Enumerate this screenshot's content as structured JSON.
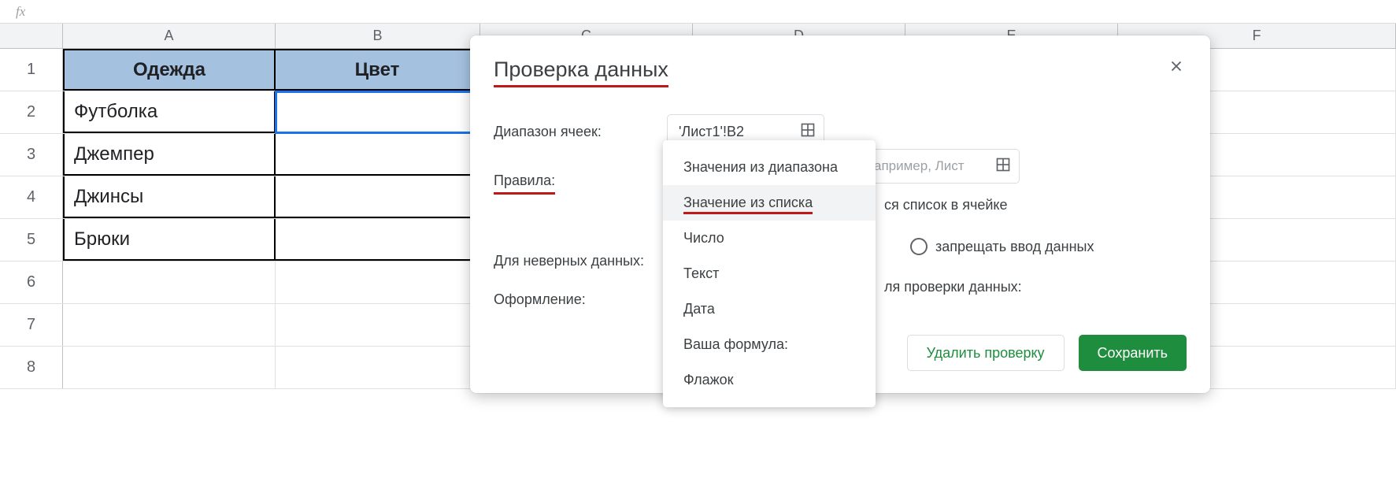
{
  "formula_bar": {
    "fx": "fx"
  },
  "columns": [
    "A",
    "B",
    "C",
    "D",
    "E",
    "F"
  ],
  "row_numbers": [
    1,
    2,
    3,
    4,
    5,
    6,
    7,
    8
  ],
  "table": {
    "header": {
      "a": "Одежда",
      "b": "Цвет"
    },
    "rows": [
      {
        "a": "Футболка",
        "b": ""
      },
      {
        "a": "Джемпер",
        "b": ""
      },
      {
        "a": "Джинсы",
        "b": ""
      },
      {
        "a": "Брюки",
        "b": ""
      }
    ]
  },
  "dialog": {
    "title": "Проверка данных",
    "range_label": "Диапазон ячеек:",
    "range_value": "'Лист1'!B2",
    "rules_label": "Правила:",
    "rules_placeholder": "апример, Лист",
    "invalid_label": "Для неверных данных:",
    "appearance_label": "Оформление:",
    "checkbox_text": "ся список в ячейке",
    "radio_label": "запрещать ввод данных",
    "validation_text": "ля проверки данных:",
    "delete_btn": "Удалить проверку",
    "save_btn": "Сохранить"
  },
  "dropdown": {
    "items": [
      "Значения из диапазона",
      "Значение из списка",
      "Число",
      "Текст",
      "Дата",
      "Ваша формула:",
      "Флажок"
    ],
    "hover_index": 1
  }
}
